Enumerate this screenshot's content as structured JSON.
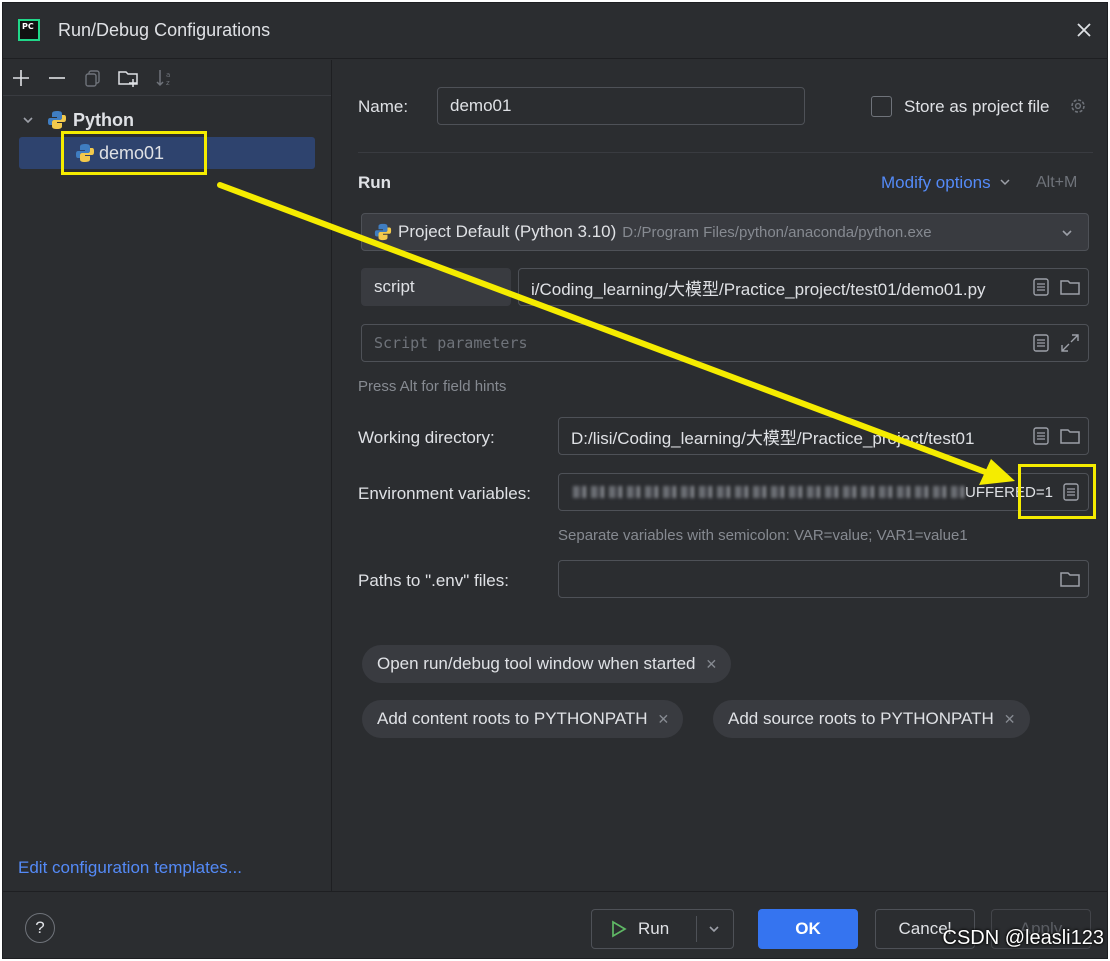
{
  "window": {
    "title": "Run/Debug Configurations",
    "logo_text": "PC"
  },
  "tree": {
    "group_label": "Python",
    "item_label": "demo01",
    "edit_templates_link": "Edit configuration templates..."
  },
  "form": {
    "name_label": "Name:",
    "name_value": "demo01",
    "store_label": "Store as project file",
    "run_section": "Run",
    "modify_options": "Modify options",
    "modify_shortcut": "Alt+M",
    "interpreter_name": "Project Default (Python 3.10)",
    "interpreter_path": "D:/Program Files/python/anaconda/python.exe",
    "script_type": "script",
    "script_path": "i/Coding_learning/大模型/Practice_project/test01/demo01.py",
    "params_placeholder": "Script parameters",
    "field_hint": "Press Alt for field hints",
    "workdir_label": "Working directory:",
    "workdir_value": "D:/lisi/Coding_learning/大模型/Practice_project/test01",
    "env_label": "Environment variables:",
    "env_value_tail": "UFFERED=1",
    "env_hint": "Separate variables with semicolon: VAR=value; VAR1=value1",
    "dotenv_label": "Paths to \".env\" files:",
    "chips": [
      "Open run/debug tool window when started",
      "Add content roots to PYTHONPATH",
      "Add source roots to PYTHONPATH"
    ]
  },
  "footer": {
    "help": "?",
    "run": "Run",
    "ok": "OK",
    "cancel": "Cancel",
    "apply": "Apply"
  },
  "watermark": "CSDN @leasli123",
  "colors": {
    "accent": "#3574f0",
    "link": "#548af7",
    "annotation": "#f5ec00",
    "bg": "#2b2d30"
  }
}
